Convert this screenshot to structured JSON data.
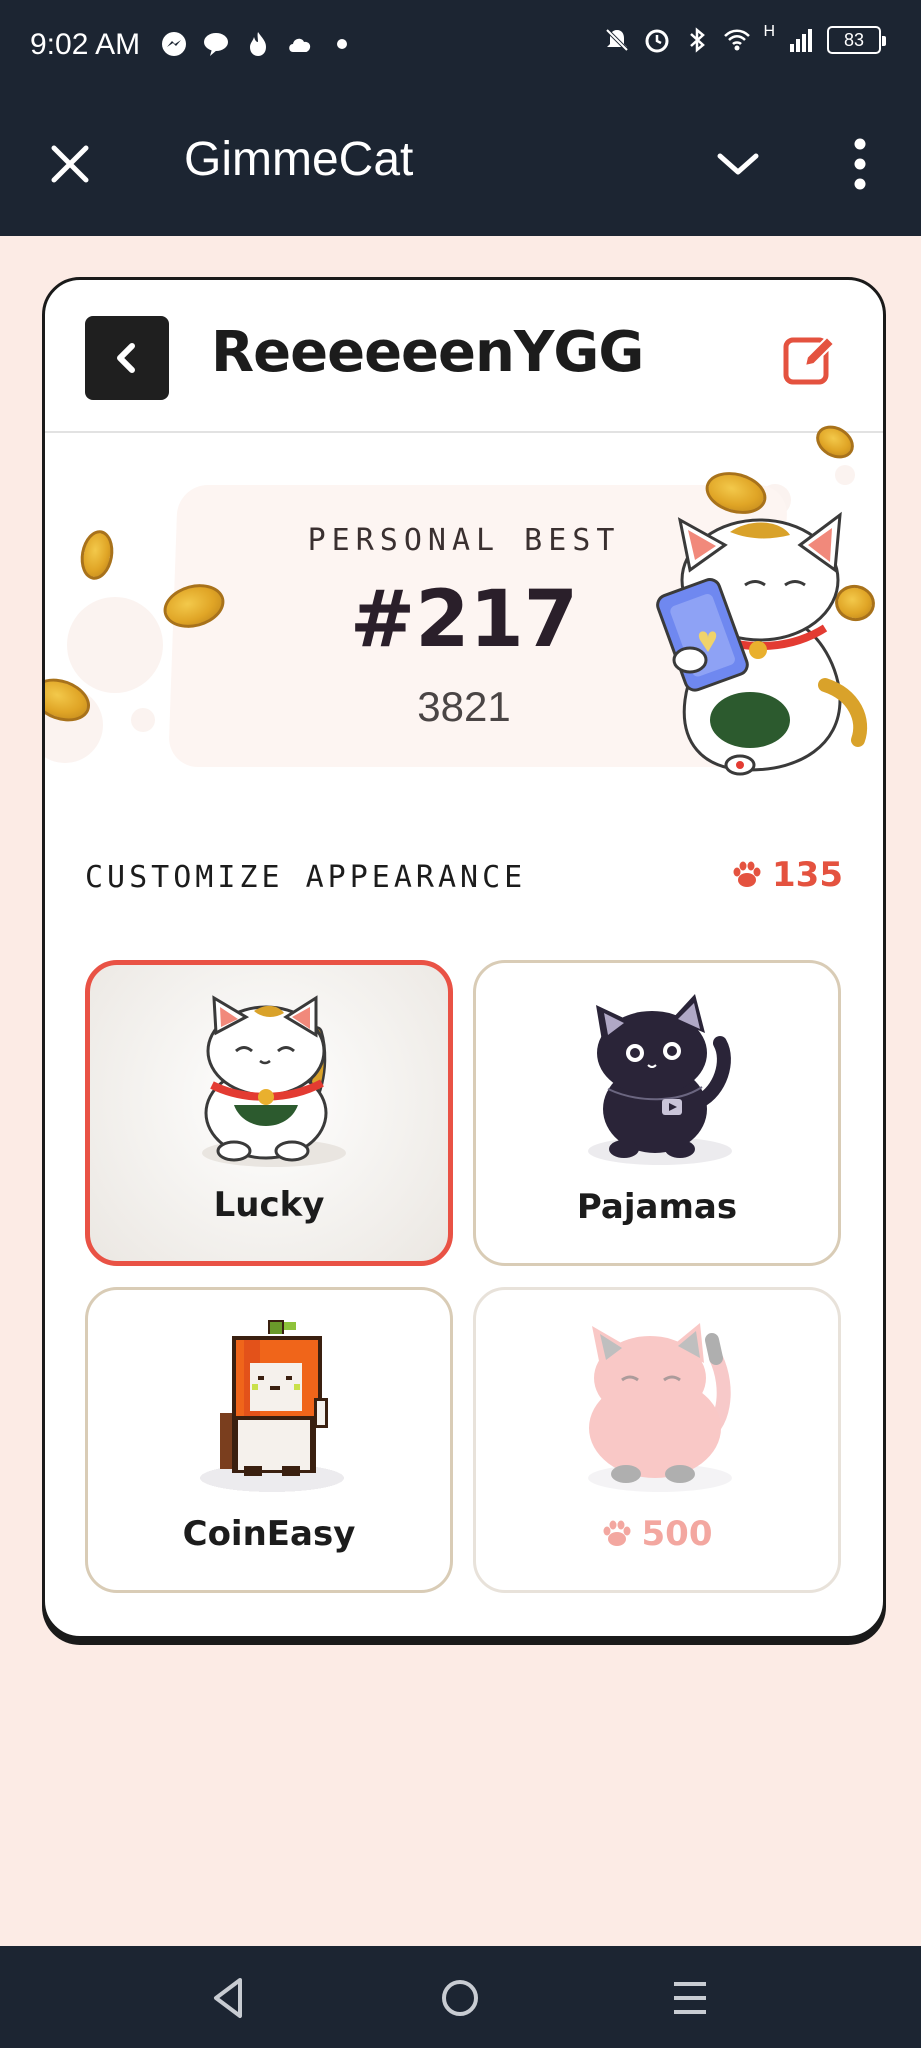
{
  "status_bar": {
    "time": "9:02 AM",
    "left_icons": [
      "messenger-icon",
      "chat-icon",
      "flame-icon",
      "cloud-icon",
      "dot-icon"
    ],
    "right_icons": [
      "mute-icon",
      "alarm-icon",
      "bluetooth-icon",
      "wifi-icon",
      "signal-icon"
    ],
    "network": "H",
    "battery": "83"
  },
  "app_bar": {
    "title": "GimmeCat",
    "background": "#1c2532"
  },
  "profile": {
    "username": "ReeeeeenYGG"
  },
  "personal_best": {
    "label": "PERSONAL BEST",
    "rank": "#217",
    "score": "3821"
  },
  "customize": {
    "title": "CUSTOMIZE APPEARANCE",
    "paw_balance": "135",
    "accent": "#e4523f",
    "skins": [
      {
        "name": "Lucky",
        "state": "selected"
      },
      {
        "name": "Pajamas",
        "state": "owned"
      },
      {
        "name": "CoinEasy",
        "state": "owned"
      },
      {
        "price": "500",
        "state": "locked"
      }
    ]
  },
  "nav_bar": {
    "buttons": [
      "back-icon",
      "home-icon",
      "recents-icon"
    ]
  }
}
